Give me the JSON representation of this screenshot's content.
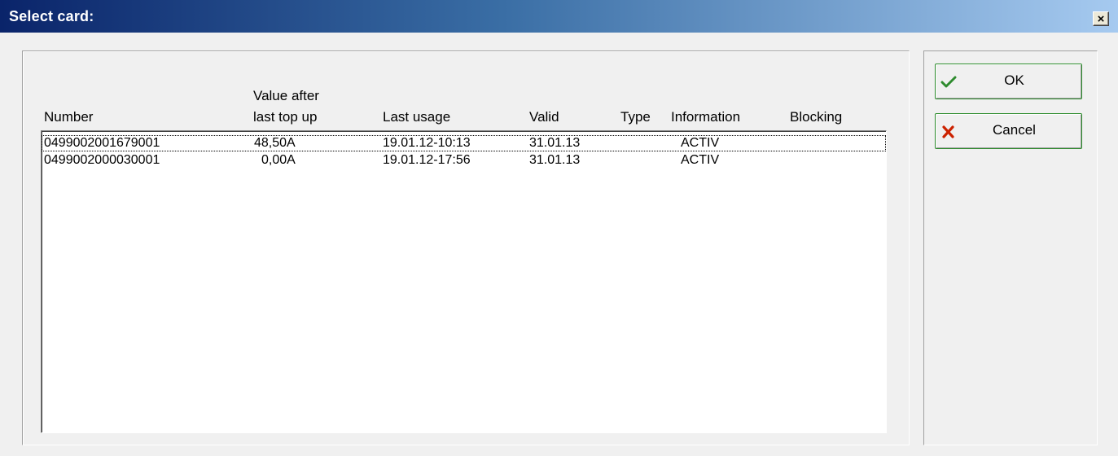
{
  "window": {
    "title": "Select card:",
    "close_label": "×"
  },
  "table": {
    "headers": {
      "number": "Number",
      "value_line1": "Value after",
      "value_line2": "last top up",
      "last_usage": "Last usage",
      "valid": "Valid",
      "type": "Type",
      "information": "Information",
      "blocking": "Blocking"
    },
    "rows": [
      {
        "number": "0499002001679001",
        "value": "48,50A",
        "last_usage": "19.01.12-10:13",
        "valid": "31.01.13",
        "type": "",
        "information": "ACTIV",
        "blocking": ""
      },
      {
        "number": "0499002000030001",
        "value": "0,00A",
        "last_usage": "19.01.12-17:56",
        "valid": "31.01.13",
        "type": "",
        "information": "ACTIV",
        "blocking": ""
      }
    ]
  },
  "buttons": {
    "ok": {
      "label": "OK",
      "icon": "checkmark-icon",
      "color": "#2e8b2e"
    },
    "cancel": {
      "label": "Cancel",
      "icon": "x-icon",
      "color": "#cc2200"
    }
  }
}
